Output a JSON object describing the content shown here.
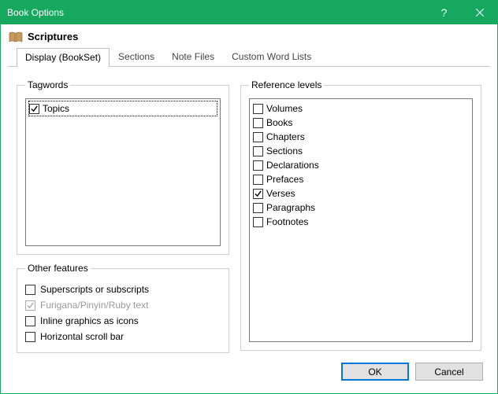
{
  "window": {
    "title": "Book Options",
    "help": "?",
    "close": "×"
  },
  "subheader": {
    "label": "Scriptures"
  },
  "tabs": [
    {
      "label": "Display (BookSet)",
      "active": true
    },
    {
      "label": "Sections",
      "active": false
    },
    {
      "label": "Note Files",
      "active": false
    },
    {
      "label": "Custom Word Lists",
      "active": false
    }
  ],
  "groups": {
    "tagwords": "Tagwords",
    "other": "Other features",
    "reference": "Reference levels"
  },
  "tagwords": [
    {
      "label": "Topics",
      "checked": true,
      "selected": true
    }
  ],
  "other_features": [
    {
      "label": "Superscripts or subscripts",
      "checked": false,
      "disabled": false
    },
    {
      "label": "Furigana/Pinyin/Ruby text",
      "checked": true,
      "disabled": true
    },
    {
      "label": "Inline graphics as icons",
      "checked": false,
      "disabled": false
    },
    {
      "label": "Horizontal scroll bar",
      "checked": false,
      "disabled": false
    }
  ],
  "reference_levels": [
    {
      "label": "Volumes",
      "checked": false
    },
    {
      "label": "Books",
      "checked": false
    },
    {
      "label": "Chapters",
      "checked": false
    },
    {
      "label": "Sections",
      "checked": false
    },
    {
      "label": "Declarations",
      "checked": false
    },
    {
      "label": "Prefaces",
      "checked": false
    },
    {
      "label": "Verses",
      "checked": true
    },
    {
      "label": "Paragraphs",
      "checked": false
    },
    {
      "label": "Footnotes",
      "checked": false
    }
  ],
  "buttons": {
    "ok": "OK",
    "cancel": "Cancel"
  }
}
